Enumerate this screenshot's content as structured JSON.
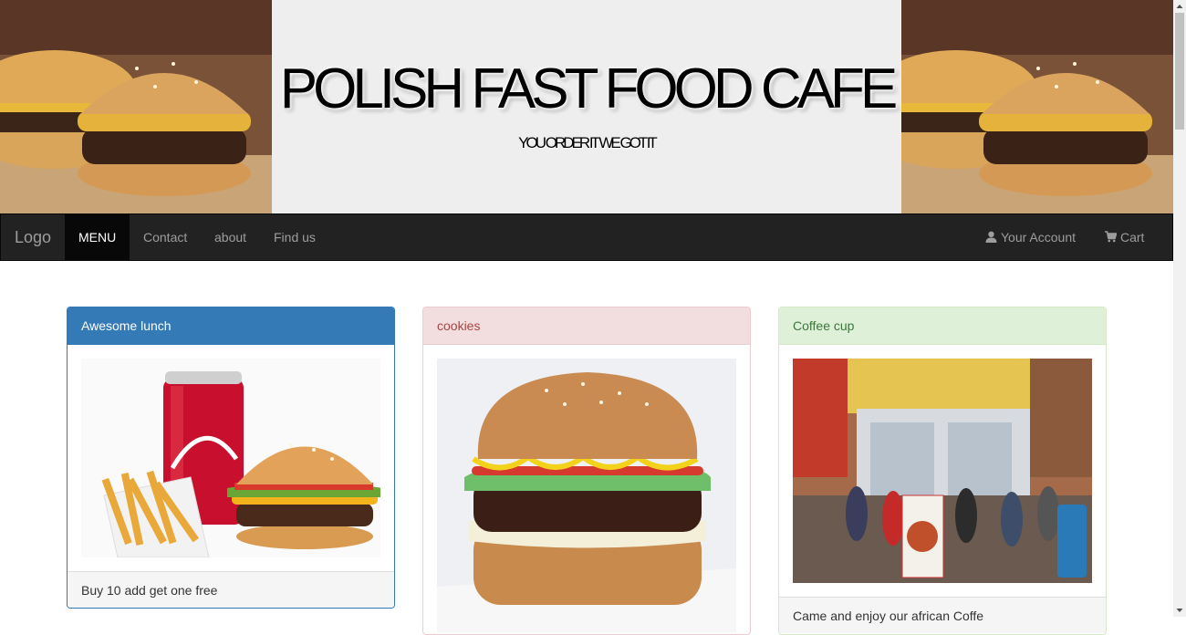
{
  "hero": {
    "title": "POLISH FAST FOOD CAFE",
    "subtitle": "YOU ORDER IT WE GOT IT",
    "left_image": "burger-photo",
    "right_image": "burger-photo"
  },
  "navbar": {
    "brand": "Logo",
    "items": [
      {
        "label": "MENU",
        "active": true
      },
      {
        "label": "Contact",
        "active": false
      },
      {
        "label": "about",
        "active": false
      },
      {
        "label": "Find us",
        "active": false
      }
    ],
    "right_items": [
      {
        "label": "Your Account",
        "icon": "user-icon"
      },
      {
        "label": "Cart",
        "icon": "shopping-cart-icon"
      }
    ]
  },
  "panels": [
    {
      "heading": "Awesome lunch",
      "style": "primary",
      "image": "cola-burger-fries-photo",
      "footer": "Buy 10 add get one free"
    },
    {
      "heading": "cookies",
      "style": "danger",
      "image": "burger-cake-photo",
      "footer": ""
    },
    {
      "heading": "Coffee cup",
      "style": "success",
      "image": "kapkata-shop-photo",
      "footer": "Came and enjoy our african Coffe"
    }
  ],
  "colors": {
    "primary": "#337ab7",
    "danger_bg": "#f2dede",
    "danger_text": "#a94442",
    "success_bg": "#dff0d8",
    "success_text": "#3c763d",
    "navbar_bg": "#222222"
  }
}
